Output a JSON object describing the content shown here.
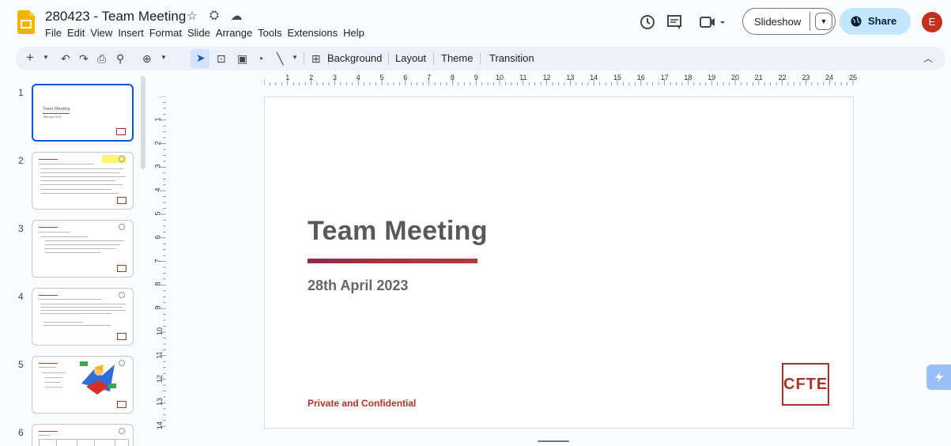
{
  "header": {
    "doc_title": "280423 - Team Meeting",
    "menu": [
      "File",
      "Edit",
      "View",
      "Insert",
      "Format",
      "Slide",
      "Arrange",
      "Tools",
      "Extensions",
      "Help"
    ],
    "slideshow_label": "Slideshow",
    "share_label": "Share",
    "avatar_initial": "E"
  },
  "toolbar": {
    "background_label": "Background",
    "layout_label": "Layout",
    "theme_label": "Theme",
    "transition_label": "Transition"
  },
  "filmstrip": {
    "slide_numbers": [
      "1",
      "2",
      "3",
      "4",
      "5",
      "6"
    ]
  },
  "rulers": {
    "h": [
      "1",
      "2",
      "3",
      "4",
      "5",
      "6",
      "7",
      "8",
      "9",
      "10",
      "11",
      "12",
      "13",
      "14",
      "15",
      "16",
      "17",
      "18",
      "19",
      "20",
      "21",
      "22",
      "23",
      "24",
      "25"
    ],
    "v": [
      "1",
      "2",
      "3",
      "4",
      "5",
      "6",
      "7",
      "8",
      "9",
      "10",
      "11",
      "12",
      "13",
      "14"
    ]
  },
  "slide": {
    "title": "Team Meeting",
    "date": "28th April 2023",
    "confidential": "Private and Confidential",
    "logo_text": "CFTE"
  },
  "thumb1": {
    "title": "Team Meeting",
    "date": "28th April 2023"
  },
  "colors": {
    "accent": "#0b57d0",
    "brand_red": "#a93226",
    "share_bg": "#c2e7ff"
  }
}
